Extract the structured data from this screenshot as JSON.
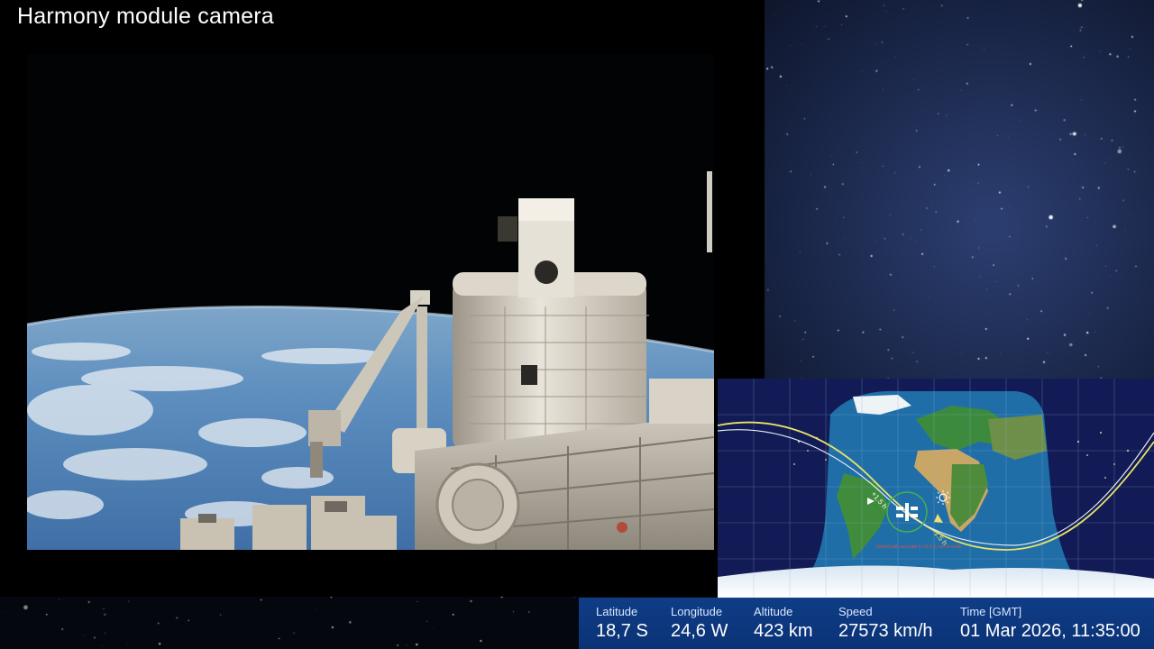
{
  "camera": {
    "title": "Harmony module camera"
  },
  "map": {
    "track_labels": {
      "ahead": "+1.5 h",
      "behind": "-1.5 h"
    },
    "caption": "Orbital path accurate to ±1.5 h; not to scale"
  },
  "telemetry": {
    "latitude": {
      "label": "Latitude",
      "value": "18,7 S"
    },
    "longitude": {
      "label": "Longitude",
      "value": "24,6 W"
    },
    "altitude": {
      "label": "Altitude",
      "value": "423 km"
    },
    "speed": {
      "label": "Speed",
      "value": "27573 km/h"
    },
    "time": {
      "label": "Time [GMT]",
      "value": "01 Mar 2026, 11:35:00"
    }
  },
  "colors": {
    "bar_bg": "#0f3d86",
    "map_night": "#121b55",
    "map_day_ocean": "#1f6ea8",
    "track_yellow": "#e8e36a",
    "track_white": "#e6ecf2"
  },
  "icons": {
    "iss": "iss-icon",
    "sun": "sun-icon"
  }
}
